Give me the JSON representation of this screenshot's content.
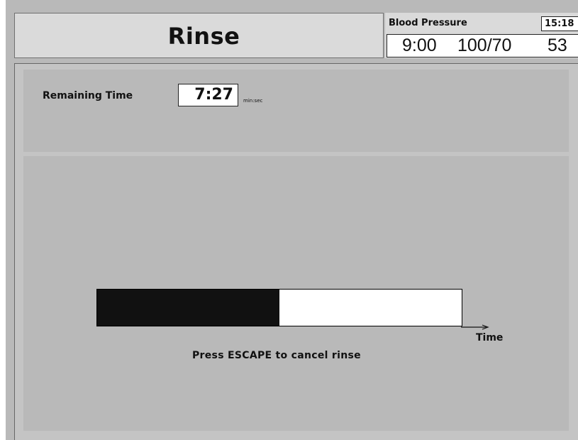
{
  "header": {
    "title": "Rinse"
  },
  "blood_pressure": {
    "label": "Blood Pressure",
    "clock": "15:18",
    "time": "9:00",
    "pressure": "100/70",
    "pulse": "53"
  },
  "remaining": {
    "label": "Remaining Time",
    "value": "7:27",
    "unit": "min:sec"
  },
  "progress": {
    "fraction": 0.5,
    "axis_label": "Time",
    "fill_color": "#111111",
    "empty_color": "#ffffff"
  },
  "instructions": {
    "escape_text": "Press ESCAPE to cancel rinse"
  },
  "colors": {
    "panel": "#b9b9b9",
    "title_bg": "#dadada"
  }
}
